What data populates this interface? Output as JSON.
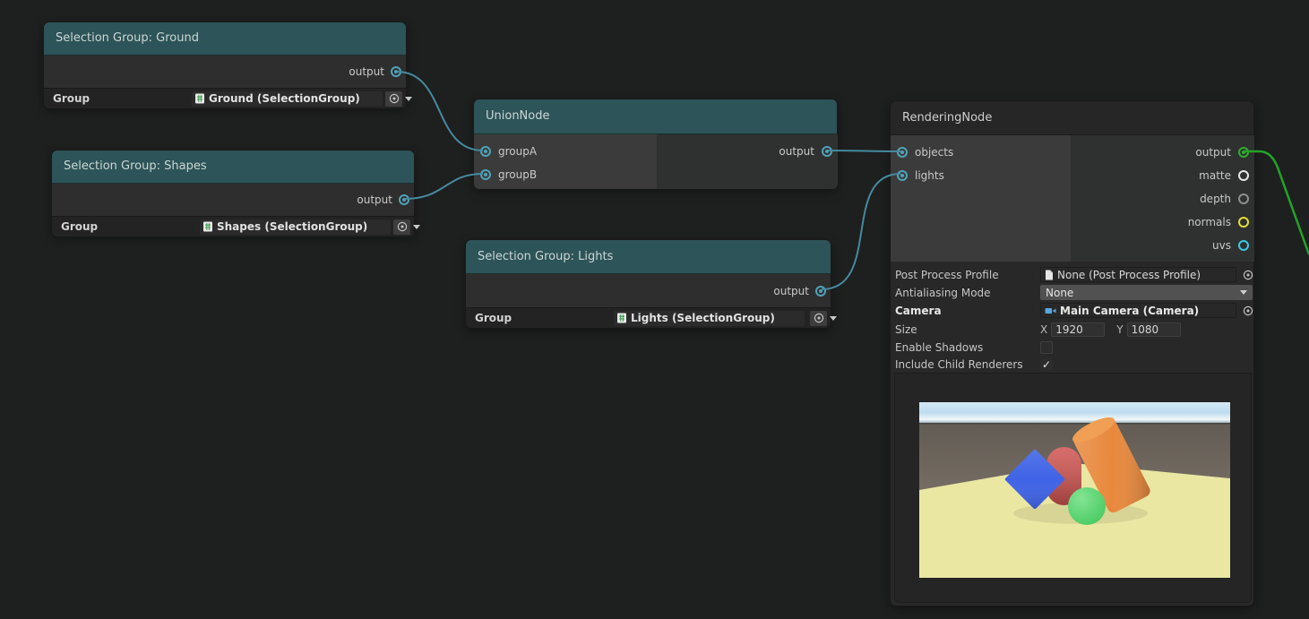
{
  "colors": {
    "canvas_bg": "#1e1f1f",
    "header_teal": "#2d5458",
    "edge_group": "#468aa0",
    "edge_render": "#23a328",
    "port_cyan": "#4fa3ba"
  },
  "nodes": {
    "ground": {
      "title": "Selection Group: Ground",
      "output_label": "output",
      "group_label": "Group",
      "group_value": "Ground (SelectionGroup)"
    },
    "shapes": {
      "title": "Selection Group: Shapes",
      "output_label": "output",
      "group_label": "Group",
      "group_value": "Shapes (SelectionGroup)"
    },
    "lights_group": {
      "title": "Selection Group: Lights",
      "output_label": "output",
      "group_label": "Group",
      "group_value": "Lights (SelectionGroup)"
    },
    "union": {
      "title": "UnionNode",
      "input_a": "groupA",
      "input_b": "groupB",
      "output_label": "output"
    },
    "rendering": {
      "title": "RenderingNode",
      "input_objects": "objects",
      "input_lights": "lights",
      "outputs": [
        {
          "label": "output",
          "color": "#2fae2f"
        },
        {
          "label": "matte",
          "color": "#e8e8e8"
        },
        {
          "label": "depth",
          "color": "#8f8f8f"
        },
        {
          "label": "normals",
          "color": "#e5df33"
        },
        {
          "label": "uvs",
          "color": "#38cce6"
        }
      ],
      "properties": {
        "post_process_profile": {
          "label": "Post Process Profile",
          "value": "None (Post Process Profile)"
        },
        "antialiasing_mode": {
          "label": "Antialiasing Mode",
          "value": "None"
        },
        "camera": {
          "label": "Camera",
          "value": "Main Camera (Camera)"
        },
        "size": {
          "label": "Size",
          "x_label": "X",
          "x_value": "1920",
          "y_label": "Y",
          "y_value": "1080"
        },
        "enable_shadows": {
          "label": "Enable Shadows",
          "check_glyph": ""
        },
        "include_child_renderers": {
          "label": "Include Child Renderers",
          "check_glyph": "✓"
        }
      },
      "preview_scene": {
        "description": "Camera preview: blue cube, red capsule, orange cylinder, green sphere on pale yellow ground",
        "sky_top": "#d6eaf5",
        "sky_mid": "#bddcee",
        "sky_bottom": "#f2f8fa",
        "bg_top": "#5d564f",
        "bg_bottom": "#8d8478",
        "ground": "#eae7a3",
        "cube": "#3f63e6",
        "capsule": "#d05450",
        "cylinder": "#e8883c",
        "cylinder_cap": "#f09f55",
        "sphere": "#3fc75b",
        "sphere_highlight": "#84e494"
      }
    }
  }
}
